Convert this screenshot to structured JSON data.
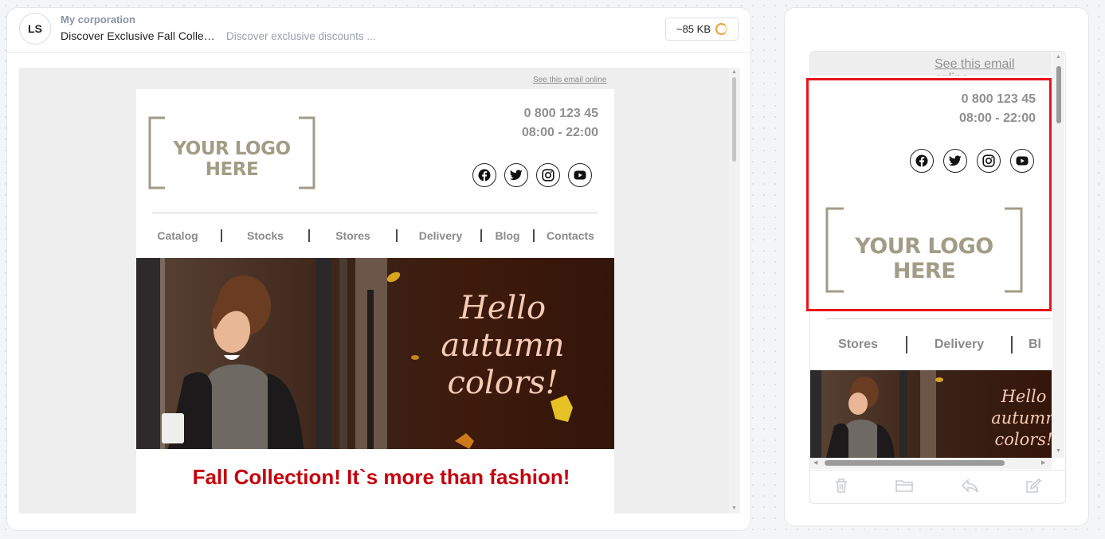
{
  "header": {
    "avatar_initials": "LS",
    "sender_name": "My corporation",
    "subject": "Discover Exclusive Fall Collect...",
    "preheader": "Discover exclusive discounts ...",
    "size": "~85 KB"
  },
  "email": {
    "see_online": "See this email online",
    "phone": "0 800 123 45",
    "hours": "08:00 - 22:00",
    "logo_text": "YOUR LOGO HERE",
    "social_icons": [
      "facebook-icon",
      "twitter-icon",
      "instagram-icon",
      "youtube-icon"
    ],
    "nav": [
      "Catalog",
      "Stocks",
      "Stores",
      "Delivery",
      "Blog",
      "Contacts"
    ],
    "banner_text_lines": [
      "Hello",
      "autumn",
      "colors!"
    ],
    "headline": "Fall Collection! It`s more than fashion!"
  },
  "mobile_preview": {
    "see_online": "See this email online",
    "phone": "0 800 123 45",
    "hours": "08:00 - 22:00",
    "logo_text": "YOUR LOGO HERE",
    "nav_visible": [
      "Stores",
      "Delivery",
      "Bl"
    ],
    "banner_text_lines": [
      "Hello",
      "autumn",
      "colors!"
    ],
    "toolbar_icons": [
      "trash-icon",
      "folder-icon",
      "reply-icon",
      "edit-icon"
    ]
  },
  "colors": {
    "headline_red": "#c5000c",
    "highlight_red": "#e8131b",
    "logo_khaki": "#a29c86",
    "banner_brown": "#3d1a0c",
    "banner_text_peach": "#f7cbb5",
    "spinner_orange": "#f0a030"
  }
}
